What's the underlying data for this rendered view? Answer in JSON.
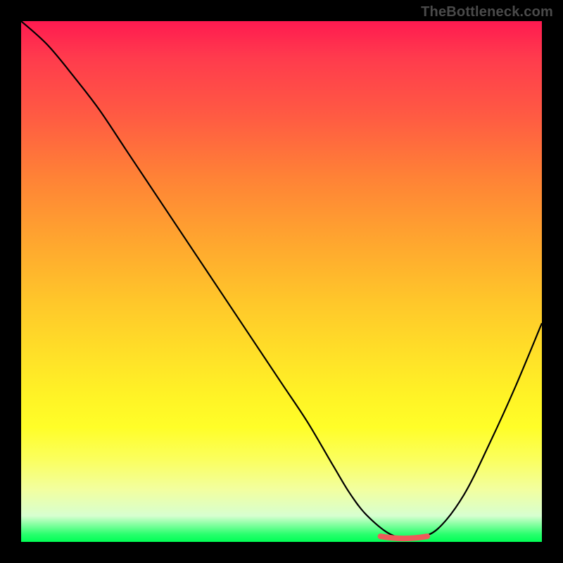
{
  "attribution": "TheBottleneck.com",
  "chart_data": {
    "type": "line",
    "title": "",
    "xlabel": "",
    "ylabel": "",
    "xlim": [
      0,
      10
    ],
    "ylim": [
      0,
      10
    ],
    "x": [
      0.0,
      0.5,
      1.0,
      1.5,
      2.0,
      2.5,
      3.0,
      3.5,
      4.0,
      4.5,
      5.0,
      5.5,
      6.0,
      6.3,
      6.6,
      7.0,
      7.3,
      7.6,
      8.0,
      8.5,
      9.0,
      9.5,
      10.0
    ],
    "values": [
      10.0,
      9.55,
      8.95,
      8.3,
      7.55,
      6.8,
      6.05,
      5.3,
      4.55,
      3.8,
      3.05,
      2.3,
      1.45,
      0.95,
      0.55,
      0.2,
      0.08,
      0.08,
      0.25,
      0.9,
      1.9,
      3.0,
      4.2
    ],
    "highlight_range_x": [
      6.9,
      7.8
    ],
    "highlight_y": 0.08,
    "grid": false,
    "legend": false,
    "background_gradient": [
      "#ff1a50",
      "#ffe028",
      "#00ff55"
    ]
  }
}
